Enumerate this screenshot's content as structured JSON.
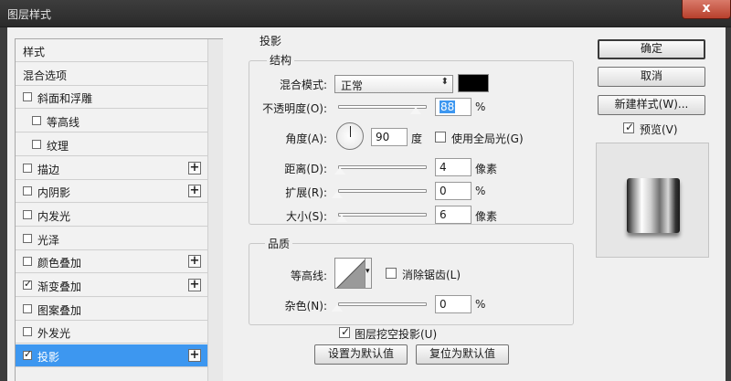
{
  "window": {
    "title": "图层样式",
    "close_label": "x"
  },
  "style_list": {
    "items": [
      {
        "label": "样式",
        "checkbox": false,
        "checked": false,
        "plus": false,
        "indent": 0,
        "selected": false
      },
      {
        "label": "混合选项",
        "checkbox": false,
        "checked": false,
        "plus": false,
        "indent": 0,
        "selected": false
      },
      {
        "label": "斜面和浮雕",
        "checkbox": true,
        "checked": false,
        "plus": false,
        "indent": 0,
        "selected": false
      },
      {
        "label": "等高线",
        "checkbox": true,
        "checked": false,
        "plus": false,
        "indent": 1,
        "selected": false
      },
      {
        "label": "纹理",
        "checkbox": true,
        "checked": false,
        "plus": false,
        "indent": 1,
        "selected": false
      },
      {
        "label": "描边",
        "checkbox": true,
        "checked": false,
        "plus": true,
        "indent": 0,
        "selected": false
      },
      {
        "label": "内阴影",
        "checkbox": true,
        "checked": false,
        "plus": true,
        "indent": 0,
        "selected": false
      },
      {
        "label": "内发光",
        "checkbox": true,
        "checked": false,
        "plus": false,
        "indent": 0,
        "selected": false
      },
      {
        "label": "光泽",
        "checkbox": true,
        "checked": false,
        "plus": false,
        "indent": 0,
        "selected": false
      },
      {
        "label": "颜色叠加",
        "checkbox": true,
        "checked": false,
        "plus": true,
        "indent": 0,
        "selected": false
      },
      {
        "label": "渐变叠加",
        "checkbox": true,
        "checked": true,
        "plus": true,
        "indent": 0,
        "selected": false
      },
      {
        "label": "图案叠加",
        "checkbox": true,
        "checked": false,
        "plus": false,
        "indent": 0,
        "selected": false
      },
      {
        "label": "外发光",
        "checkbox": true,
        "checked": false,
        "plus": false,
        "indent": 0,
        "selected": false
      },
      {
        "label": "投影",
        "checkbox": true,
        "checked": true,
        "plus": true,
        "indent": 0,
        "selected": true
      }
    ],
    "plus_glyph": "+"
  },
  "drop_shadow": {
    "section_title": "投影",
    "structure": {
      "title": "结构",
      "blend_mode_label": "混合模式:",
      "blend_mode_value": "正常",
      "blend_color": "#000000",
      "opacity_label": "不透明度(O):",
      "opacity_value": "88",
      "opacity_unit": "%",
      "angle_label": "角度(A):",
      "angle_value": "90",
      "angle_unit": "度",
      "global_light_label": "使用全局光(G)",
      "global_light_checked": false,
      "distance_label": "距离(D):",
      "distance_value": "4",
      "distance_unit": "像素",
      "spread_label": "扩展(R):",
      "spread_value": "0",
      "spread_unit": "%",
      "size_label": "大小(S):",
      "size_value": "6",
      "size_unit": "像素"
    },
    "quality": {
      "title": "品质",
      "contour_label": "等高线:",
      "anti_alias_label": "消除锯齿(L)",
      "anti_alias_checked": false,
      "noise_label": "杂色(N):",
      "noise_value": "0",
      "noise_unit": "%"
    },
    "knockout_label": "图层挖空投影(U)",
    "knockout_checked": true,
    "make_default_label": "设置为默认值",
    "reset_default_label": "复位为默认值"
  },
  "right_panel": {
    "ok_label": "确定",
    "cancel_label": "取消",
    "new_style_label": "新建样式(W)...",
    "preview_label": "预览(V)",
    "preview_checked": true
  },
  "colors": {
    "selection": "#3d97f0",
    "panel": "#f0f0f0"
  }
}
